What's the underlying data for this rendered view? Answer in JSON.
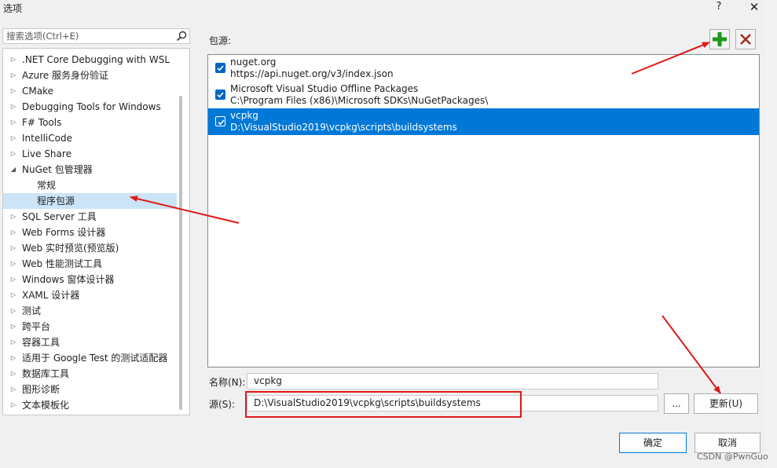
{
  "window": {
    "title": "选项",
    "help": "?",
    "close": "✕"
  },
  "search": {
    "placeholder": "搜索选项(Ctrl+E)"
  },
  "tree": {
    "items": [
      {
        "label": ".NET Core Debugging with WSL",
        "arrow": "▷"
      },
      {
        "label": "Azure 服务身份验证",
        "arrow": "▷"
      },
      {
        "label": "CMake",
        "arrow": "▷"
      },
      {
        "label": "Debugging Tools for Windows",
        "arrow": "▷"
      },
      {
        "label": "F# Tools",
        "arrow": "▷"
      },
      {
        "label": "IntelliCode",
        "arrow": "▷"
      },
      {
        "label": "Live Share",
        "arrow": "▷"
      },
      {
        "label": "NuGet 包管理器",
        "arrow": "◢"
      },
      {
        "label": "常规",
        "arrow": ""
      },
      {
        "label": "程序包源",
        "arrow": ""
      },
      {
        "label": "SQL Server 工具",
        "arrow": "▷"
      },
      {
        "label": "Web Forms 设计器",
        "arrow": "▷"
      },
      {
        "label": "Web 实时预览(预览版)",
        "arrow": "▷"
      },
      {
        "label": "Web 性能测试工具",
        "arrow": "▷"
      },
      {
        "label": "Windows 窗体设计器",
        "arrow": "▷"
      },
      {
        "label": "XAML 设计器",
        "arrow": "▷"
      },
      {
        "label": "测试",
        "arrow": "▷"
      },
      {
        "label": "跨平台",
        "arrow": "▷"
      },
      {
        "label": "容器工具",
        "arrow": "▷"
      },
      {
        "label": "适用于 Google Test 的测试适配器",
        "arrow": "▷"
      },
      {
        "label": "数据库工具",
        "arrow": "▷"
      },
      {
        "label": "图形诊断",
        "arrow": "▷"
      },
      {
        "label": "文本模板化",
        "arrow": "▷"
      }
    ]
  },
  "sources": {
    "label": "包源:",
    "items": [
      {
        "name": "nuget.org",
        "url": "https://api.nuget.org/v3/index.json",
        "checked": true
      },
      {
        "name": "Microsoft Visual Studio Offline Packages",
        "url": "C:\\Program Files (x86)\\Microsoft SDKs\\NuGetPackages\\",
        "checked": true
      },
      {
        "name": "vcpkg",
        "url": "D:\\VisualStudio2019\\vcpkg\\scripts\\buildsystems",
        "checked": true
      }
    ]
  },
  "form": {
    "name_label": "名称(N):",
    "name_value": "vcpkg",
    "source_label": "源(S):",
    "source_value": "D:\\VisualStudio2019\\vcpkg\\scripts\\buildsystems",
    "browse": "...",
    "update": "更新(U)"
  },
  "buttons": {
    "ok": "确定",
    "cancel": "取消"
  },
  "watermark": "CSDN @PwnGuo",
  "colors": {
    "accent": "#0078d7",
    "annotation": "#e01818",
    "add": "#1a9a1a",
    "delete": "#a03020"
  }
}
